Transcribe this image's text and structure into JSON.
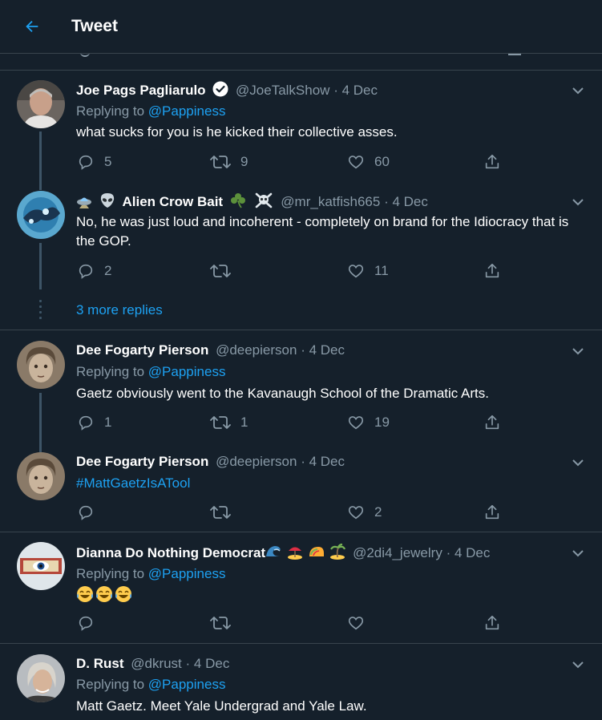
{
  "header": {
    "title": "Tweet"
  },
  "more_replies": "3 more replies",
  "tweets": [
    {
      "name": "Joe Pags Pagliarulo",
      "handle": "@JoeTalkShow",
      "date": "· 4 Dec",
      "verified": true,
      "replying_label": "Replying to",
      "replying_to": "@Pappiness",
      "text": "what sucks for you is he kicked their collective asses.",
      "replies": "5",
      "retweets": "9",
      "likes": "60"
    },
    {
      "name": "Alien Crow Bait",
      "name_emoji": [
        "ufo",
        "alien",
        "shamrock",
        "skull-crossbones"
      ],
      "handle": "@mr_katfish665",
      "date": "· 4 Dec",
      "text": "No, he was just loud and incoherent - completely on brand for the Idiocracy that is the GOP.",
      "replies": "2",
      "retweets": "",
      "likes": "11"
    },
    {
      "name": "Dee Fogarty Pierson",
      "handle": "@deepierson",
      "date": "· 4 Dec",
      "replying_label": "Replying to",
      "replying_to": "@Pappiness",
      "text": "Gaetz obviously went to the Kavanaugh School of the Dramatic Arts.",
      "replies": "1",
      "retweets": "1",
      "likes": "19"
    },
    {
      "name": "Dee Fogarty Pierson",
      "handle": "@deepierson",
      "date": "· 4 Dec",
      "text": "#MattGaetzIsATool",
      "replies": "",
      "retweets": "",
      "likes": "2"
    },
    {
      "name": "Dianna Do Nothing Democrat",
      "name_emoji": [
        "wave",
        "beach-umbrella",
        "taco",
        "island"
      ],
      "handle": "@2di4_jewelry",
      "date": "· 4 Dec",
      "replying_label": "Replying to",
      "replying_to": "@Pappiness",
      "text_emoji": [
        "laughing-tears",
        "laughing-tears",
        "laughing-tears"
      ],
      "replies": "",
      "retweets": "",
      "likes": ""
    },
    {
      "name": "D. Rust",
      "handle": "@dkrust",
      "date": "· 4 Dec",
      "replying_label": "Replying to",
      "replying_to": "@Pappiness",
      "text": "Matt Gaetz. Meet Yale Undergrad and Yale Law."
    }
  ],
  "colors": {
    "background": "#15202b",
    "border": "#38444d",
    "accent": "#1da1f2",
    "muted": "#8899a6"
  }
}
